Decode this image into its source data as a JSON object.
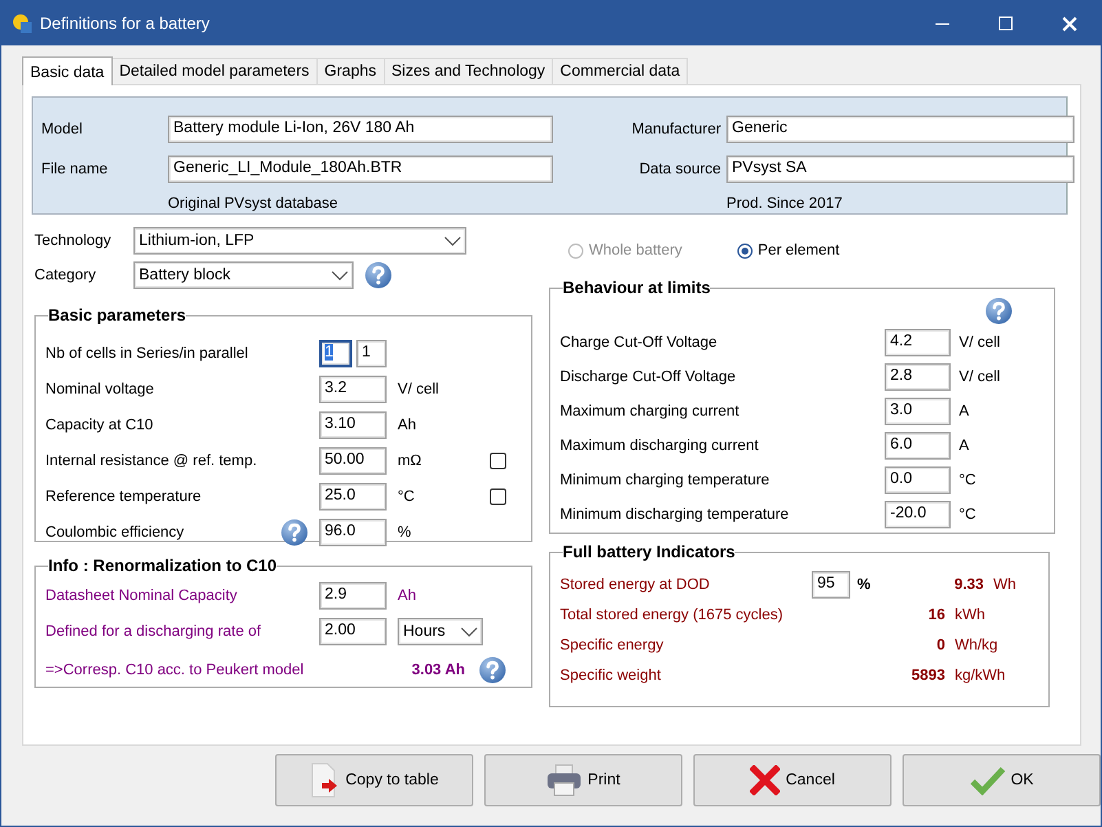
{
  "window": {
    "title": "Definitions for a battery"
  },
  "tabs": [
    {
      "label": "Basic data",
      "selected": true
    },
    {
      "label": "Detailed model parameters",
      "selected": false
    },
    {
      "label": "Graphs",
      "selected": false
    },
    {
      "label": "Sizes and Technology",
      "selected": false
    },
    {
      "label": "Commercial data",
      "selected": false
    }
  ],
  "identity": {
    "left": [
      {
        "label": "Model",
        "value": "Battery module Li-Ion, 26V 180 Ah"
      },
      {
        "label": "File name",
        "value": "Generic_LI_Module_180Ah.BTR"
      }
    ],
    "left_note": "Original PVsyst database",
    "right": [
      {
        "label": "Manufacturer",
        "value": "Generic"
      },
      {
        "label": "Data source",
        "value": "PVsyst SA"
      }
    ],
    "right_note": "Prod. Since 2017"
  },
  "technology": {
    "label": "Technology",
    "value": "Lithium-ion, LFP"
  },
  "category": {
    "label": "Category",
    "value": "Battery block"
  },
  "size_mode": [
    {
      "label": "Whole battery",
      "selected": false,
      "disabled": true
    },
    {
      "label": "Per element",
      "selected": true,
      "disabled": false
    }
  ],
  "basic_parameters": {
    "title": "Basic parameters",
    "rows": [
      {
        "label": "Nb of cells in Series/in parallel",
        "fields": [
          {
            "value": "1",
            "focused": true
          },
          {
            "value": "1",
            "focused": false
          }
        ]
      },
      {
        "label": "Nominal voltage",
        "fields": [
          {
            "value": "3.2",
            "focused": false
          }
        ],
        "unit": "V/ cell"
      },
      {
        "label": "Capacity at C10",
        "fields": [
          {
            "value": "3.10",
            "focused": false
          }
        ],
        "unit": "Ah"
      },
      {
        "label": "Internal resistance @ ref. temp.",
        "fields": [
          {
            "value": "50.00",
            "focused": false
          }
        ],
        "unit": "mΩ",
        "checked": false
      },
      {
        "label": "Reference temperature",
        "fields": [
          {
            "value": "25.0",
            "focused": false
          }
        ],
        "unit": "°C",
        "checked": false
      },
      {
        "label": "Coulombic efficiency",
        "help": true,
        "fields": [
          {
            "value": "96.0",
            "focused": false
          }
        ],
        "unit": "%"
      }
    ]
  },
  "renormalization": {
    "title": "Info : Renormalization to C10",
    "rows": [
      {
        "kind": "field",
        "label": "Datasheet Nominal Capacity",
        "value": "2.9",
        "unit": "Ah"
      },
      {
        "kind": "dropdown",
        "label": "Defined for a discharging rate of",
        "value": "2.00",
        "option": "Hours"
      },
      {
        "kind": "result",
        "label": "=>Corresp. C10 acc. to Peukert model",
        "value": "3.03 Ah"
      }
    ]
  },
  "behaviour": {
    "title": "Behaviour at limits",
    "rows": [
      {
        "label": "Charge Cut-Off Voltage",
        "value": "4.2",
        "unit": "V/ cell"
      },
      {
        "label": "Discharge Cut-Off Voltage",
        "value": "2.8",
        "unit": "V/ cell"
      },
      {
        "label": "Maximum charging current",
        "value": "3.0",
        "unit": "A"
      },
      {
        "label": "Maximum discharging current",
        "value": "6.0",
        "unit": "A"
      },
      {
        "label": "Minimum charging temperature",
        "value": "0.0",
        "unit": "°C"
      },
      {
        "label": "Minimum discharging temperature",
        "value": "-20.0",
        "unit": "°C"
      }
    ]
  },
  "indicators": {
    "title": "Full battery Indicators",
    "rows": [
      {
        "label": "Stored energy at DOD",
        "input": "95",
        "input_unit": "%",
        "value": "9.33",
        "unit": "Wh"
      },
      {
        "label": "Total stored energy (1675 cycles)",
        "value": "16",
        "unit": "kWh"
      },
      {
        "label": "Specific energy",
        "value": "0",
        "unit": "Wh/kg"
      },
      {
        "label": "Specific weight",
        "value": "5893",
        "unit": "kg/kWh"
      }
    ]
  },
  "buttons": [
    {
      "kind": "copy",
      "label": "Copy to table"
    },
    {
      "kind": "print",
      "label": "Print"
    },
    {
      "kind": "cancel",
      "label": "Cancel"
    },
    {
      "kind": "ok",
      "label": "OK"
    }
  ]
}
